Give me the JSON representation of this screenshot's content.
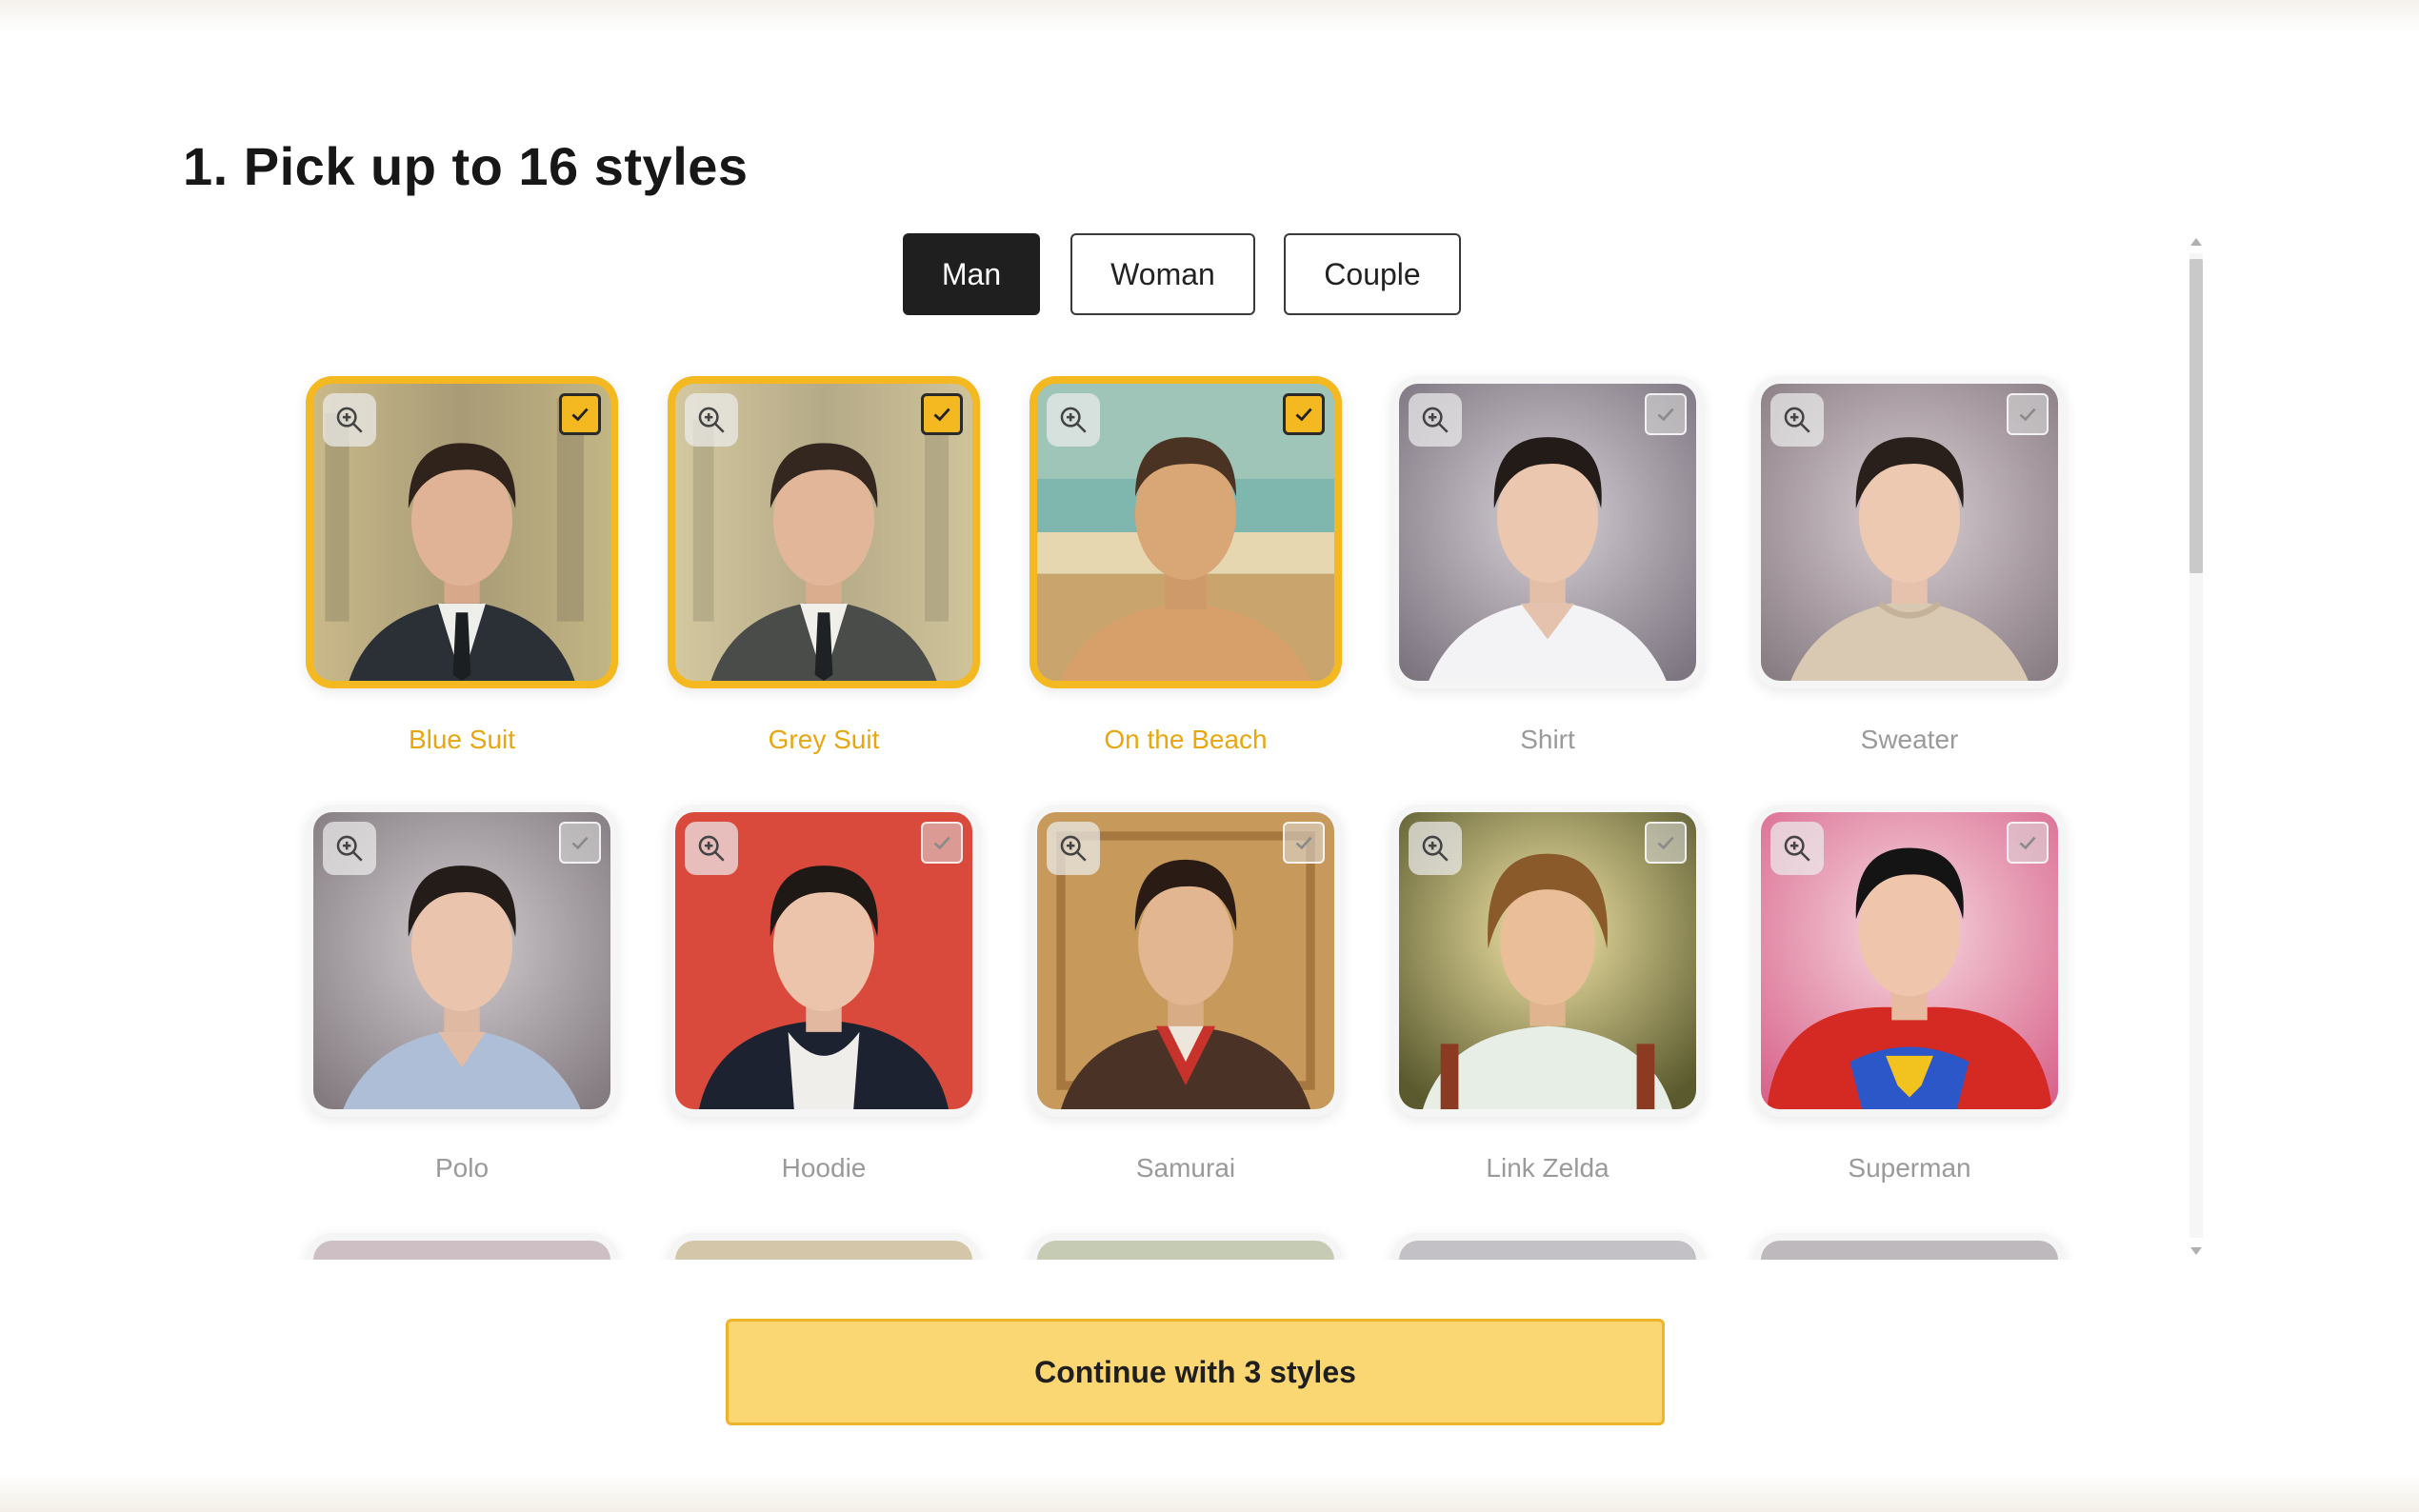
{
  "heading": "1. Pick up to 16 styles",
  "tabs": [
    {
      "label": "Man",
      "active": true
    },
    {
      "label": "Woman",
      "active": false
    },
    {
      "label": "Couple",
      "active": false
    }
  ],
  "styles": [
    {
      "label": "Blue Suit",
      "selected": true
    },
    {
      "label": "Grey Suit",
      "selected": true
    },
    {
      "label": "On the Beach",
      "selected": true
    },
    {
      "label": "Shirt",
      "selected": false
    },
    {
      "label": "Sweater",
      "selected": false
    },
    {
      "label": "Polo",
      "selected": false
    },
    {
      "label": "Hoodie",
      "selected": false
    },
    {
      "label": "Samurai",
      "selected": false
    },
    {
      "label": "Link Zelda",
      "selected": false
    },
    {
      "label": "Superman",
      "selected": false
    }
  ],
  "icons": {
    "zoom": "zoom-in-icon",
    "check": "check-icon"
  },
  "continue_label": "Continue with 3 styles",
  "colors": {
    "accent": "#f4b820",
    "accent_text": "#e8a711",
    "button_fill": "#fbd774",
    "active_tab": "#1f1f1f"
  }
}
